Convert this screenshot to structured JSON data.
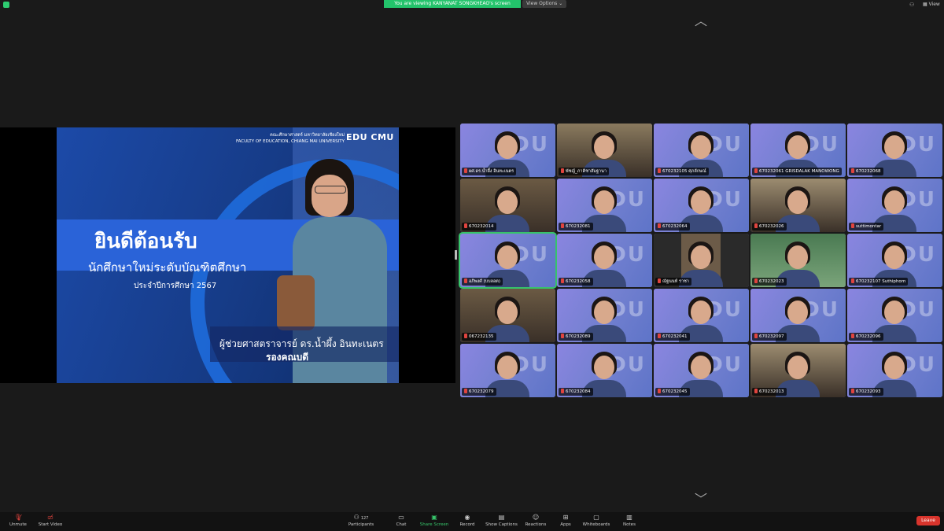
{
  "top_bar": {
    "banner": "You are viewing KANYANAT SONGKHEAO's screen",
    "view_options": "View Options",
    "view_label": "View"
  },
  "slide": {
    "faculty_th": "คณะศึกษาศาสตร์ มหาวิทยาลัยเชียงใหม่",
    "faculty_en": "FACULTY OF EDUCATION, CHIANG MAI UNIVERSITY",
    "logo": "EDU CMU",
    "welcome": "ยินดีต้อนรับ",
    "subtitle": "นักศึกษาใหม่ระดับบัณฑิตศึกษา",
    "year_label": "ประจำปีการศึกษา  2567",
    "person_name": "ผู้ช่วยศาสตราจารย์ ดร.น้ำผึ้ง  อินทะเนตร",
    "person_role": "รองคณบดี"
  },
  "gallery": {
    "participants": [
      {
        "name": "ผศ.ดร.น้ำผึ้ง อินทะเนตร",
        "bg": "edu"
      },
      {
        "name": "พัชญ์_ภาคิชาสัมฐานา",
        "bg": "room"
      },
      {
        "name": "670232105 ศุภลักษณ์",
        "bg": "edu"
      },
      {
        "name": "670232061 GRISDALAK MANOWONG",
        "bg": "edu"
      },
      {
        "name": "670232068",
        "bg": "edu"
      },
      {
        "name": "670232014",
        "bg": "room"
      },
      {
        "name": "670232081",
        "bg": "edu"
      },
      {
        "name": "670232064",
        "bg": "edu"
      },
      {
        "name": "670232026",
        "bg": "room"
      },
      {
        "name": "suttimontar",
        "bg": "edu"
      },
      {
        "name": "อภิพงศ์ (บบลอต)",
        "bg": "edu"
      },
      {
        "name": "670232058",
        "bg": "edu"
      },
      {
        "name": "ณัฐนนท์ ราชา",
        "bg": "dark"
      },
      {
        "name": "670232023",
        "bg": "green"
      },
      {
        "name": "670232107 Suthiphorn",
        "bg": "edu"
      },
      {
        "name": "067232135",
        "bg": "room"
      },
      {
        "name": "670232089",
        "bg": "edu"
      },
      {
        "name": "670232041",
        "bg": "edu"
      },
      {
        "name": "670232097",
        "bg": "edu"
      },
      {
        "name": "670232096",
        "bg": "edu"
      },
      {
        "name": "670232079",
        "bg": "edu"
      },
      {
        "name": "670232084",
        "bg": "edu"
      },
      {
        "name": "670232045",
        "bg": "edu"
      },
      {
        "name": "670232013",
        "bg": "room"
      },
      {
        "name": "670232093",
        "bg": "edu"
      }
    ]
  },
  "toolbar": {
    "unmute": "Unmute",
    "start_video": "Start Video",
    "participants": "Participants",
    "participants_count": "127",
    "chat": "Chat",
    "share_screen": "Share Screen",
    "record": "Record",
    "show_captions": "Show Captions",
    "reactions": "Reactions",
    "apps": "Apps",
    "whiteboards": "Whiteboards",
    "notes": "Notes",
    "leave": "Leave"
  },
  "colors": {
    "accent_green": "#23c36b",
    "leave_red": "#d8342c",
    "background": "#1a1a1a"
  }
}
